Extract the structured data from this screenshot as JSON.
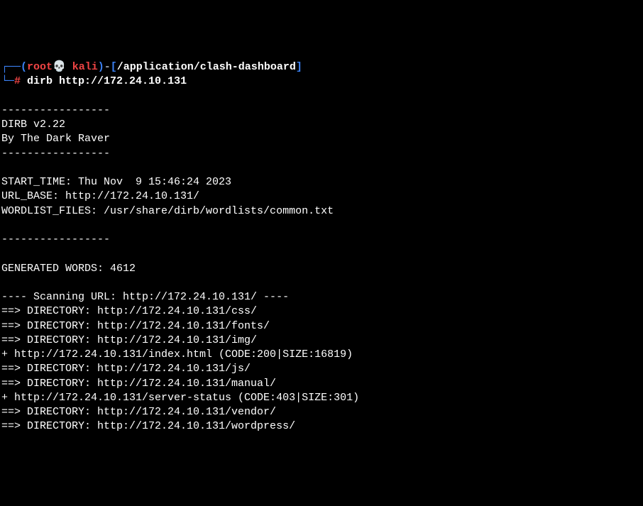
{
  "prompt": {
    "corner_open": "┌──(",
    "user": "root",
    "skull": "💀",
    "host": " kali",
    "close_paren": ")",
    "dash": "-",
    "bracket_open": "[",
    "path": "/application/clash-dashboard",
    "bracket_close": "]",
    "line2_prefix": "└─",
    "hash": "#",
    "command": " dirb http://172.24.10.131"
  },
  "output": {
    "blank1": "",
    "sep1": "-----------------",
    "banner1": "DIRB v2.22    ",
    "banner2": "By The Dark Raver",
    "sep2": "-----------------",
    "blank2": "",
    "start_time": "START_TIME: Thu Nov  9 15:46:24 2023",
    "url_base": "URL_BASE: http://172.24.10.131/",
    "wordlist": "WORDLIST_FILES: /usr/share/dirb/wordlists/common.txt",
    "blank3": "",
    "sep3": "-----------------",
    "blank4": "",
    "generated": "GENERATED WORDS: 4612                                                          ",
    "blank5": "",
    "scanning": "---- Scanning URL: http://172.24.10.131/ ----",
    "dir_css": "==> DIRECTORY: http://172.24.10.131/css/                                                ",
    "dir_fonts": "==> DIRECTORY: http://172.24.10.131/fonts/                                              ",
    "dir_img": "==> DIRECTORY: http://172.24.10.131/img/                                                ",
    "idx": "+ http://172.24.10.131/index.html (CODE:200|SIZE:16819)                                 ",
    "dir_js": "==> DIRECTORY: http://172.24.10.131/js/                                                 ",
    "dir_manual": "==> DIRECTORY: http://172.24.10.131/manual/                                             ",
    "server_status": "+ http://172.24.10.131/server-status (CODE:403|SIZE:301)                                ",
    "dir_vendor": "==> DIRECTORY: http://172.24.10.131/vendor/                                             ",
    "dir_wordpress": "==> DIRECTORY: http://172.24.10.131/wordpress/                                          "
  }
}
